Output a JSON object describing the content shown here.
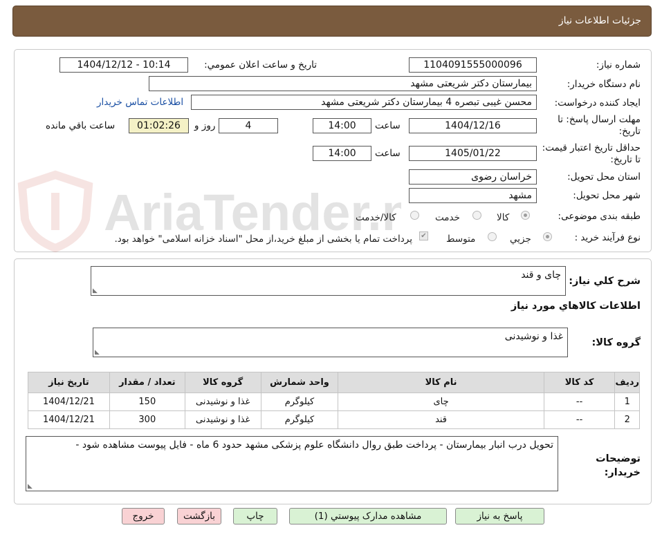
{
  "header": {
    "title": "جزئیات اطلاعات نیاز"
  },
  "watermark": {
    "text": "AriaTender.neT"
  },
  "form": {
    "need_number_label": "شماره نیاز:",
    "need_number": "1104091555000096",
    "announce_label": "تاریخ و ساعت اعلان عمومي:",
    "announce_value": "1404/12/12 - 10:14",
    "buyer_org_label": "نام دستگاه خريدار:",
    "buyer_org": "بیمارستان دکتر شریعتی مشهد",
    "requester_label": "ايجاد کننده درخواست:",
    "requester": "محسن غیبی تبصره 4 بیمارستان دکتر شریعتی مشهد",
    "contact_link": "اطلاعات تماس خريدار",
    "deadline_label": "مهلت ارسال پاسخ: تا تاريخ:",
    "deadline_date": "1404/12/16",
    "time_label": "ساعت",
    "deadline_time": "14:00",
    "days_value": "4",
    "days_label": "روز و",
    "remaining_time": "01:02:26",
    "remaining_label": "ساعت باقي مانده",
    "validity_label": "حداقل تاريخ اعتبار قيمت: تا تاريخ:",
    "validity_date": "1405/01/22",
    "validity_time": "14:00",
    "province_label": "استان محل تحويل:",
    "province": "خراسان رضوی",
    "city_label": "شهر محل تحويل:",
    "city": "مشهد",
    "category_label": "طبقه بندی موضوعی:",
    "category_options": [
      "کالا",
      "خدمت",
      "کالا/خدمت"
    ],
    "process_label": "نوع فرآیند خرید :",
    "process_options": [
      "جزیي",
      "متوسط"
    ],
    "payment_note": "پرداخت تمام يا بخشی از مبلغ خريد،از محل \"اسناد خزانه اسلامی\" خواهد بود."
  },
  "summary": {
    "description_label": "شرح کلي نياز:",
    "description": "چای و قند",
    "goods_info_title": "اطلاعات کالاهاي مورد نياز",
    "goods_group_label": "گروه کالا:",
    "goods_group": "غذا و نوشیدنی",
    "table": {
      "headers": [
        "رديف",
        "کد کالا",
        "نام کالا",
        "واحد شمارش",
        "گروه کالا",
        "تعداد / مقدار",
        "تاريخ نياز"
      ],
      "rows": [
        [
          "1",
          "--",
          "چای",
          "کیلوگرم",
          "غذا و نوشیدنی",
          "150",
          "1404/12/21"
        ],
        [
          "2",
          "--",
          "قند",
          "کیلوگرم",
          "غذا و نوشیدنی",
          "300",
          "1404/12/21"
        ]
      ]
    },
    "buyer_notes_label": "توضيحات خريدار:",
    "buyer_notes": "تحویل درب انبار بیمارستان - پرداخت طبق روال دانشگاه علوم پزشکی مشهد حدود 6 ماه - فایل پیوست مشاهده شود -"
  },
  "buttons": {
    "reply": "پاسخ به نياز",
    "attachments": "مشاهده مدارک پيوستي (1)",
    "print": "چاپ",
    "back": "بازگشت",
    "exit": "خروج"
  },
  "colors": {
    "header": "#7a5b3e",
    "link": "#1a4fa3",
    "timer": "#f4f1c6",
    "green_button": "#d9f2d4",
    "pink_button": "#f9d2d4"
  }
}
